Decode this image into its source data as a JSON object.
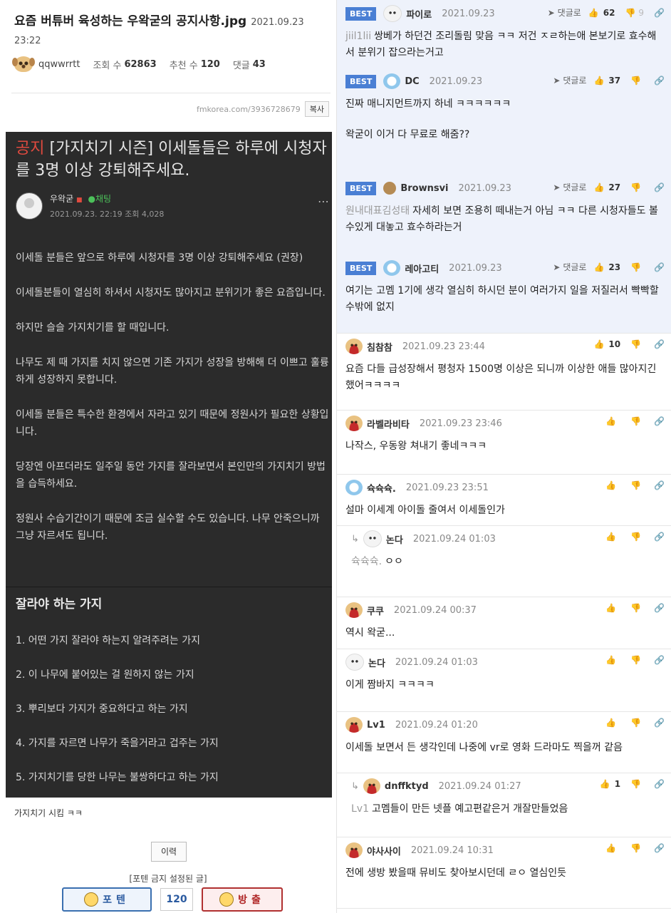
{
  "post": {
    "title": "요즘 버튜버 육성하는 우왁굳의 공지사항.jpg",
    "date": "2021.09.23 23:22",
    "author": "qqwwrrtt",
    "views_label": "조회 수",
    "views": "62863",
    "recommend_label": "추천 수",
    "recommend": "120",
    "comments_label": "댓글",
    "comments": "43",
    "url": "fmkorea.com/3936728679",
    "copy_label": "복사",
    "caption": "가지치기 시킴 ㅋㅋ",
    "history_label": "이력",
    "vote_note": "[포텐 금지 설정된 글]",
    "poten_label": "포텐",
    "vote_count": "120",
    "ban_label": "방출"
  },
  "notice": {
    "title_tag": "공지",
    "title_rest": " [가지치기 시즌] 이세돌들은 하루에 시청자를 3명 이상 강퇴해주세요.",
    "author": "우왁굳",
    "chat_label": "채팅",
    "datetime": "2021.09.23. 22:19 조회 4,028",
    "paragraphs": [
      "이세돌 분들은 앞으로 하루에 시청자를 3명 이상 강퇴해주세요 (권장)",
      "이세돌분들이 열심히 하셔서 시청자도 많아지고 분위기가 좋은 요즘입니다.",
      "하지만 슬슬 가지치기를 할 때입니다.",
      "나무도 제 때 가지를 치지 않으면 기존 가지가 성장을 방해해 더 이쁘고 훌륭하게 성장하지 못합니다.",
      "이세돌 분들은 특수한 환경에서 자라고 있기 때문에 정원사가 필요한 상황입니다.",
      "당장엔 아프더라도 일주일 동안 가지를 잘라보면서 본인만의 가지치기 방법을 습득하세요.",
      "정원사 수습기간이기 때문에 조금 실수할 수도 있습니다. 나무 안죽으니까 그냥 자르셔도 됩니다."
    ],
    "subtitle": "잘라야 하는 가지",
    "list": [
      "1. 어떤 가지 잘라야 하는지 알려주려는 가지",
      "2. 이 나무에 붙어있는 걸 원하지 않는 가지",
      "3. 뿌리보다 가지가 중요하다고 하는 가지",
      "4. 가지를 자르면 나무가 죽을거라고 겁주는 가지",
      "5. 가지치기를 당한 나무는 불쌍하다고 하는 가지"
    ]
  },
  "labels": {
    "best": "BEST",
    "reply": "댓글로"
  },
  "comments": [
    {
      "best": true,
      "avatar": "white",
      "name": "파이로",
      "date": "2021.09.23",
      "up": "62",
      "down": "9",
      "tag": "jiil1lii",
      "text": "쌍베가 하던건 조리돌림 맞음 ㅋㅋ 저건 ㅈㄹ하는애 본보기로 효수해서 분위기 잡으라는거고"
    },
    {
      "best": true,
      "avatar": "blue",
      "name": "DC",
      "date": "2021.09.23",
      "up": "37",
      "down": "",
      "tag": "",
      "text": "진짜 매니지먼트까지 하네 ㅋㅋㅋㅋㅋㅋ",
      "text2": "왁굳이 이거 다 무료로 해줌??"
    },
    {
      "best": true,
      "avatar": "brown",
      "name": "Brownsvi",
      "date": "2021.09.23",
      "up": "27",
      "down": "",
      "tag": "원내대표김성태",
      "text": "자세히 보면 조용히 떼내는거 아님 ㅋㅋ 다른 시청자들도 볼수있게 대놓고 효수하라는거"
    },
    {
      "best": true,
      "avatar": "blue",
      "name": "레아고티",
      "date": "2021.09.23",
      "up": "23",
      "down": "",
      "tag": "",
      "text": "여기는 고멤 1기에 생각 열심히 하시던 분이 여러가지 일을 저질러서 빡빡할수밖에 없지"
    },
    {
      "best": false,
      "avatar": "puppy",
      "name": "침참참",
      "date": "2021.09.23 23:44",
      "up": "10",
      "down": "",
      "tag": "",
      "text": "요즘 다들 급성장해서 평청자 1500명 이상은 되니까 이상한 애들 많아지긴 했어ㅋㅋㅋㅋ"
    },
    {
      "best": false,
      "avatar": "puppy",
      "name": "라벨라비타",
      "date": "2021.09.23 23:46",
      "up": "",
      "down": "",
      "tag": "",
      "text": "나작스, 우동왕 쳐내기 좋네ㅋㅋㅋ"
    },
    {
      "best": false,
      "avatar": "blue",
      "name": "슉슉슉.",
      "date": "2021.09.23 23:51",
      "up": "",
      "down": "",
      "tag": "",
      "text": "설마 이세계 아이돌 줄여서 이세돌인가"
    },
    {
      "best": false,
      "reply": true,
      "avatar": "white",
      "name": "논다",
      "date": "2021.09.24 01:03",
      "up": "",
      "down": "",
      "tag": "슉슉슉.",
      "text": "ㅇㅇ"
    },
    {
      "best": false,
      "avatar": "puppy",
      "name": "쿠쿠",
      "date": "2021.09.24 00:37",
      "up": "",
      "down": "",
      "tag": "",
      "text": "역시 왁굳..."
    },
    {
      "best": false,
      "avatar": "white",
      "name": "논다",
      "date": "2021.09.24 01:03",
      "up": "",
      "down": "",
      "tag": "",
      "text": "이게 짬바지 ㅋㅋㅋㅋ"
    },
    {
      "best": false,
      "avatar": "puppy",
      "name": "Lv1",
      "date": "2021.09.24 01:20",
      "up": "",
      "down": "",
      "tag": "",
      "text": "이세돌 보면서 든 생각인데 나중에 vr로 영화 드라마도 찍을꺼 같음"
    },
    {
      "best": false,
      "reply": true,
      "avatar": "puppy",
      "name": "dnffktyd",
      "date": "2021.09.24 01:27",
      "up": "1",
      "down": "",
      "tag": "Lv1",
      "text": "고멤들이 만든 넷플 예고편같은거 개잘만들었음"
    },
    {
      "best": false,
      "avatar": "puppy",
      "name": "야사사이",
      "date": "2021.09.24 10:31",
      "up": "",
      "down": "",
      "tag": "",
      "text": "전에 생방 봤을때 뮤비도 찾아보시던데 ㄹㅇ 열심인듯"
    }
  ]
}
